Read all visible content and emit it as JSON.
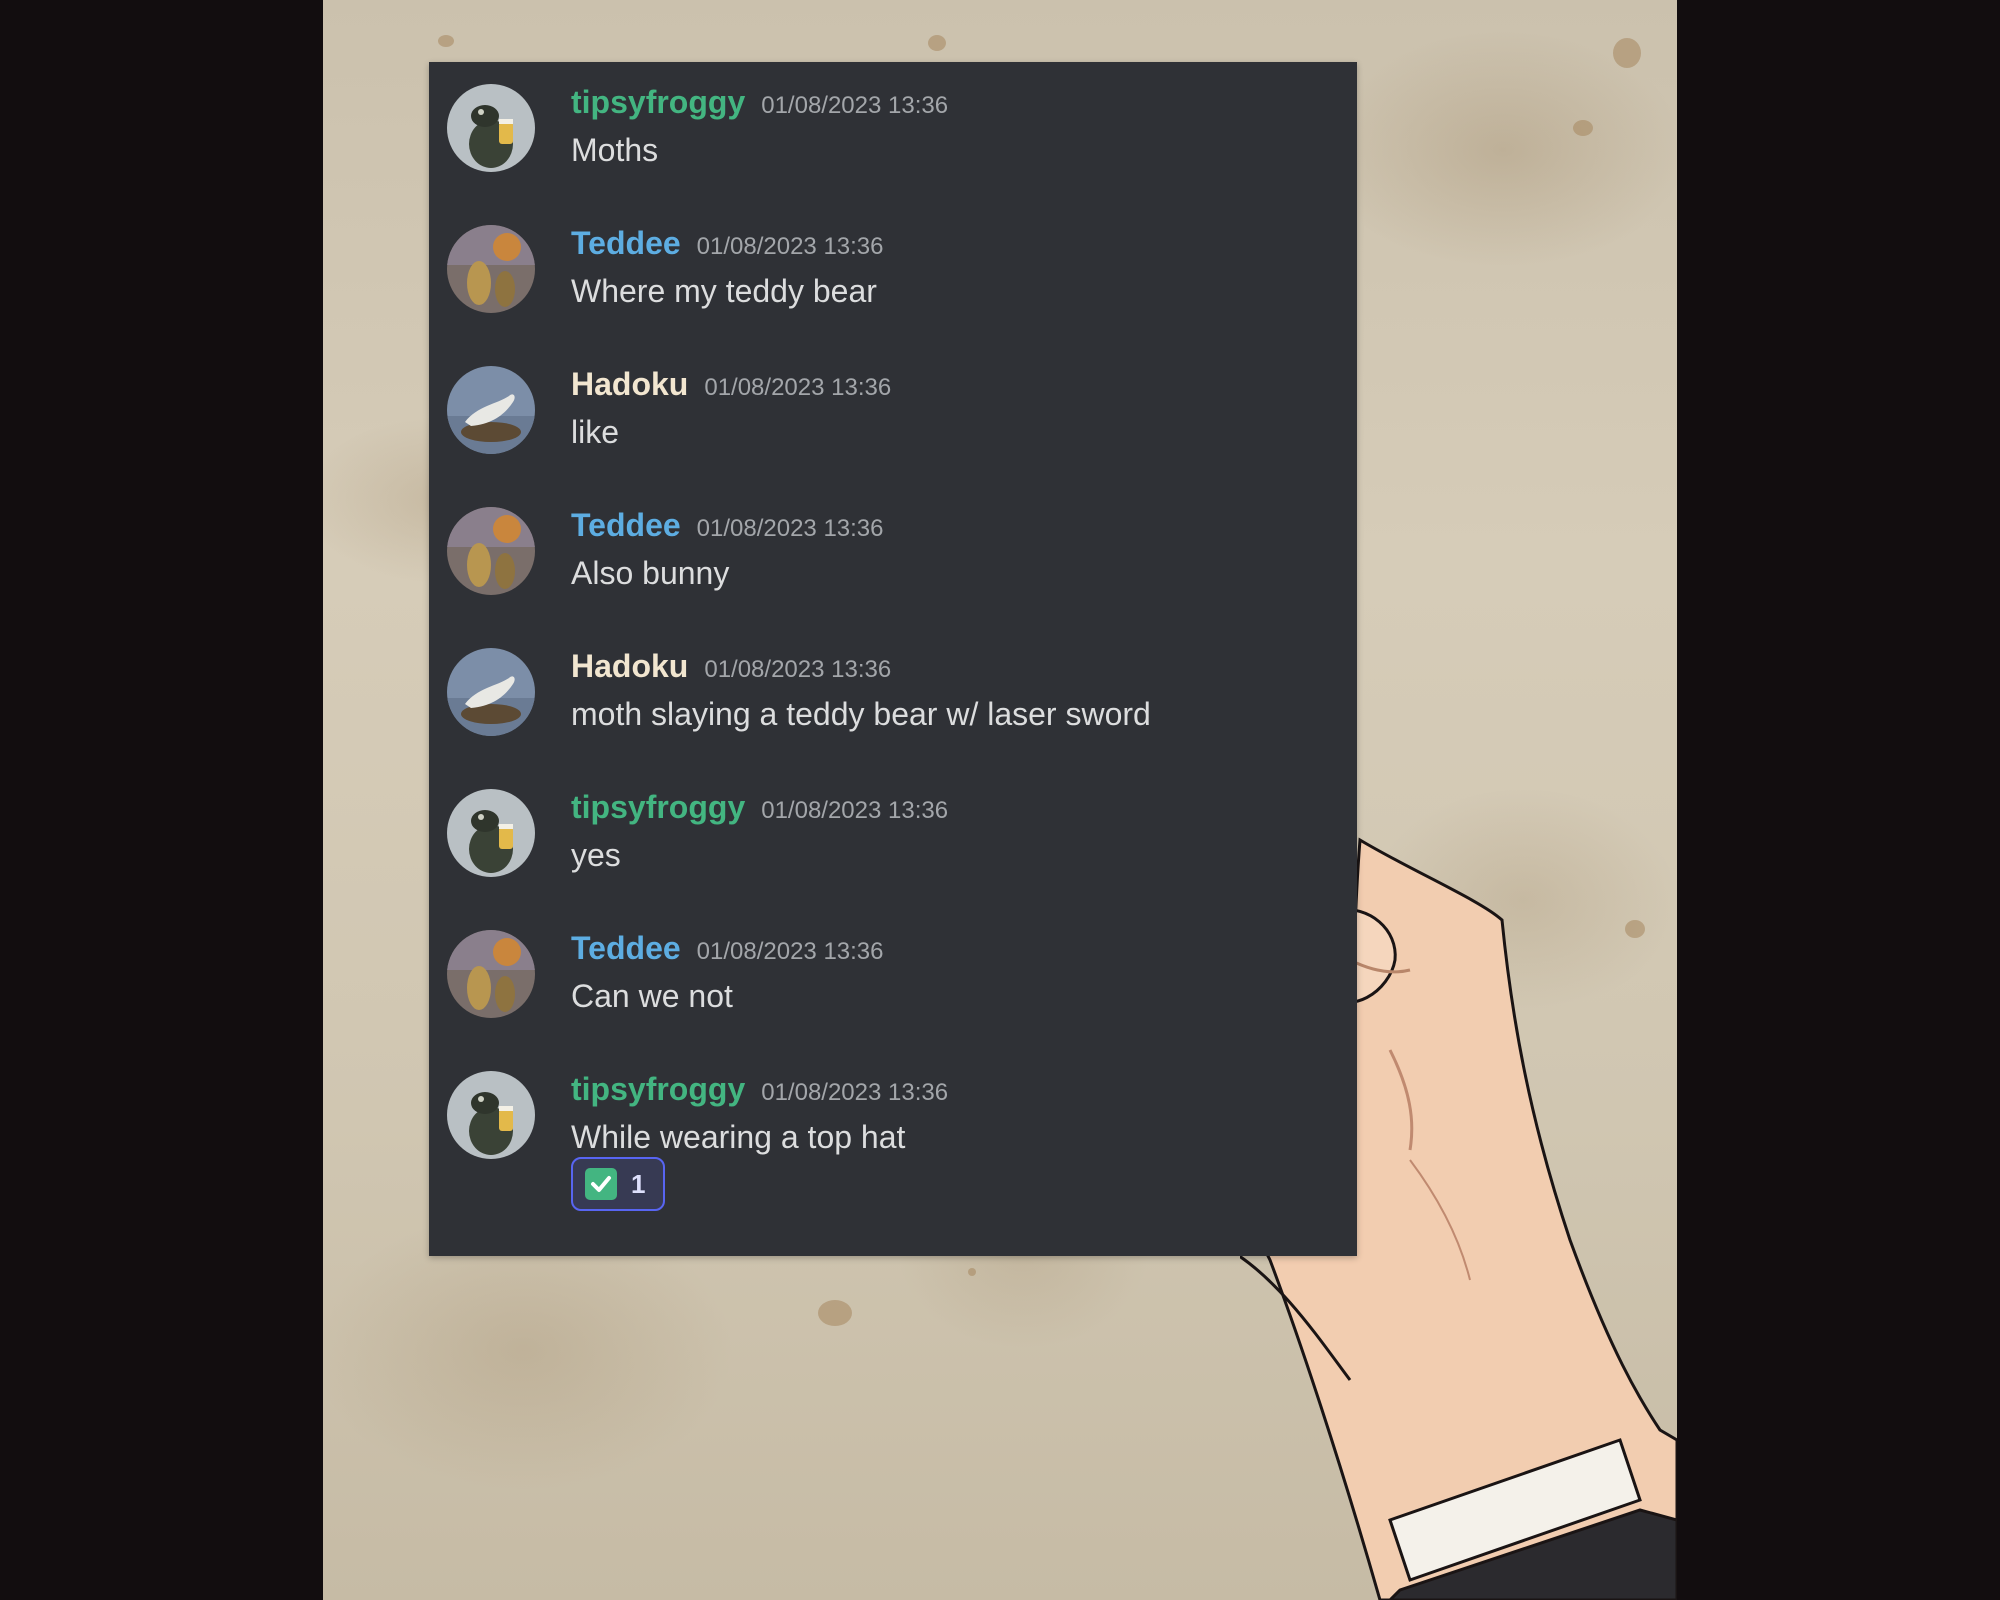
{
  "colors": {
    "panel_bg": "#2f3136",
    "text": "#dcddde",
    "timestamp": "#a3a6aa",
    "tipsyfroggy": "#43b581",
    "Teddee": "#5dade2",
    "Hadoku": "#f2e6d0",
    "reaction_border": "#5865f2"
  },
  "messages": [
    {
      "username": "tipsyfroggy",
      "avatar_icon": "frog-avatar-icon",
      "timestamp": "01/08/2023 13:36",
      "text": "Moths"
    },
    {
      "username": "Teddee",
      "avatar_icon": "painting-avatar-icon",
      "timestamp": "01/08/2023 13:36",
      "text": "Where my teddy bear"
    },
    {
      "username": "Hadoku",
      "avatar_icon": "seal-avatar-icon",
      "timestamp": "01/08/2023 13:36",
      "text": "like"
    },
    {
      "username": "Teddee",
      "avatar_icon": "painting-avatar-icon",
      "timestamp": "01/08/2023 13:36",
      "text": "Also bunny"
    },
    {
      "username": "Hadoku",
      "avatar_icon": "seal-avatar-icon",
      "timestamp": "01/08/2023 13:36",
      "text": "moth slaying a teddy bear w/ laser sword"
    },
    {
      "username": "tipsyfroggy",
      "avatar_icon": "frog-avatar-icon",
      "timestamp": "01/08/2023 13:36",
      "text": "yes"
    },
    {
      "username": "Teddee",
      "avatar_icon": "painting-avatar-icon",
      "timestamp": "01/08/2023 13:36",
      "text": "Can we not"
    },
    {
      "username": "tipsyfroggy",
      "avatar_icon": "frog-avatar-icon",
      "timestamp": "01/08/2023 13:36",
      "text": "While wearing a top hat",
      "reaction": {
        "emoji_icon": "white-check-mark-icon",
        "count": "1"
      }
    }
  ]
}
